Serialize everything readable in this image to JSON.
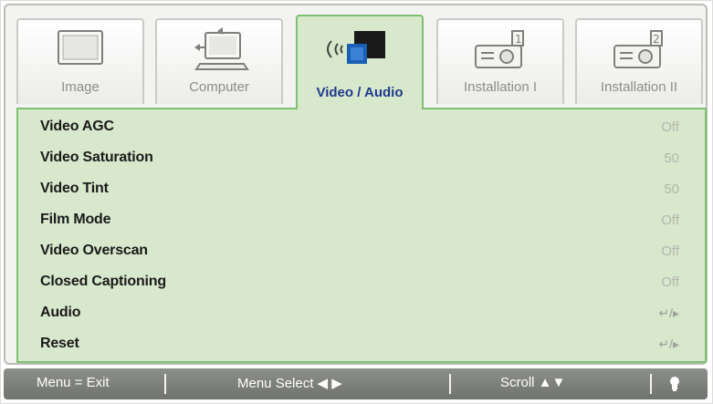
{
  "tabs": [
    {
      "label": "Image",
      "icon": "monitor-icon",
      "active": false
    },
    {
      "label": "Computer",
      "icon": "computer-icon",
      "active": false
    },
    {
      "label": "Video / Audio",
      "icon": "tv-audio-icon",
      "active": true
    },
    {
      "label": "Installation I",
      "icon": "projector-1-icon",
      "active": false
    },
    {
      "label": "Installation II",
      "icon": "projector-2-icon",
      "active": false
    }
  ],
  "menu": [
    {
      "label": "Video AGC",
      "value": "Off"
    },
    {
      "label": "Video Saturation",
      "value": "50"
    },
    {
      "label": "Video Tint",
      "value": "50"
    },
    {
      "label": "Film Mode",
      "value": "Off"
    },
    {
      "label": "Video Overscan",
      "value": "Off"
    },
    {
      "label": "Closed Captioning",
      "value": "Off"
    },
    {
      "label": "Audio",
      "value": "↵/▸"
    },
    {
      "label": "Reset",
      "value": "↵/▸"
    }
  ],
  "bottombar": {
    "exit": "Menu = Exit",
    "select": "Menu Select ◀ ▶",
    "scroll": "Scroll ▲▼",
    "help_icon": "lightbulb-icon"
  },
  "colors": {
    "panel": "#d7e8cc",
    "active_border": "#7fbf72",
    "active_label": "#1e3a8c",
    "bar": "#7d807b"
  }
}
